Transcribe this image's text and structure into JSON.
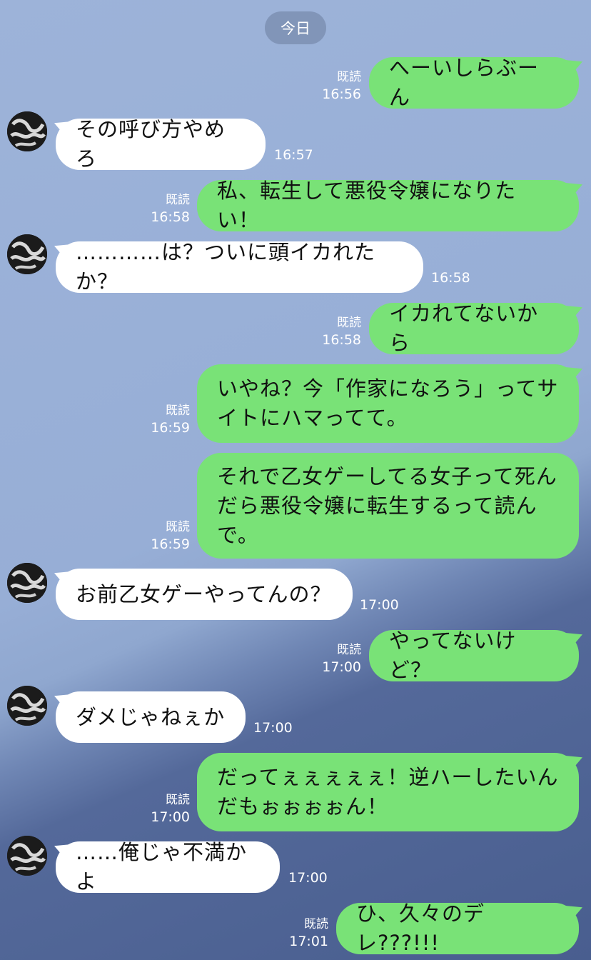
{
  "date_label": "今日",
  "read_label": "既読",
  "messages": [
    {
      "side": "sent",
      "text": "へーいしらぶーん",
      "time": "16:56"
    },
    {
      "side": "recv",
      "text": "その呼び方やめろ",
      "time": "16:57"
    },
    {
      "side": "sent",
      "text": "私、転生して悪役令嬢になりたい！",
      "time": "16:58"
    },
    {
      "side": "recv",
      "text": "…………は？ついに頭イカれたか？",
      "time": "16:58"
    },
    {
      "side": "sent",
      "text": "イカれてないから",
      "time": "16:58"
    },
    {
      "side": "sent",
      "text": "いやね？今「作家になろう」ってサイトにハマってて。",
      "time": "16:59"
    },
    {
      "side": "sent",
      "text": "それで乙女ゲーしてる女子って死んだら悪役令嬢に転生するって読んで。",
      "time": "16:59"
    },
    {
      "side": "recv",
      "text": "お前乙女ゲーやってんの？",
      "time": "17:00"
    },
    {
      "side": "sent",
      "text": "やってないけど？",
      "time": "17:00"
    },
    {
      "side": "recv",
      "text": "ダメじゃねぇか",
      "time": "17:00"
    },
    {
      "side": "sent",
      "text": "だってぇぇぇぇぇ！逆ハーしたいんだもぉぉぉぉん！",
      "time": "17:00"
    },
    {
      "side": "recv",
      "text": "……俺じゃ不満かよ",
      "time": "17:00"
    },
    {
      "side": "sent",
      "text": "ひ、久々のデレ???!!!",
      "time": "17:01"
    }
  ]
}
